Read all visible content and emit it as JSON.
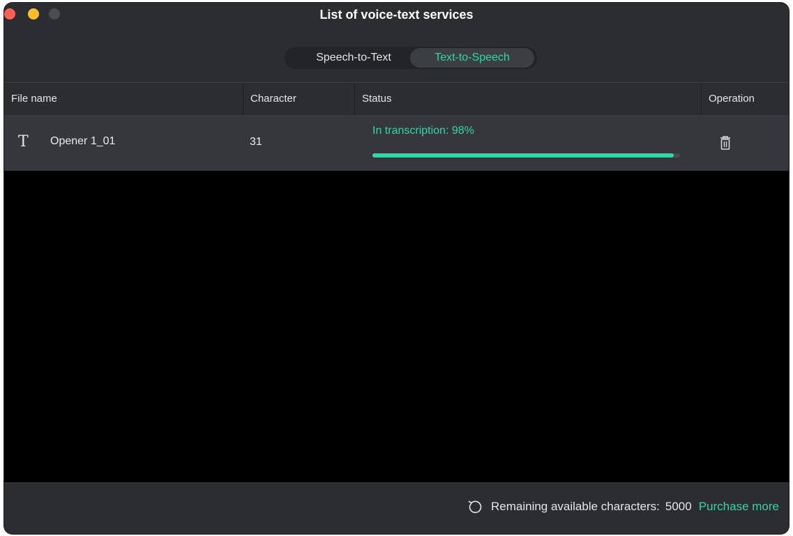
{
  "window": {
    "title": "List of voice-text services"
  },
  "tabs": [
    {
      "label": "Speech-to-Text",
      "active": false
    },
    {
      "label": "Text-to-Speech",
      "active": true
    }
  ],
  "table": {
    "columns": [
      "File name",
      "Character",
      "Status",
      "Operation"
    ],
    "rows": [
      {
        "icon": "text-type-icon",
        "icon_glyph": "T",
        "file_name": "Opener 1_01",
        "characters": "31",
        "status": "In transcription: 98%",
        "progress": 0.98,
        "operation_icon": "trash-icon"
      }
    ]
  },
  "footer": {
    "icon": "refresh-icon",
    "remaining_label": "Remaining available characters:",
    "remaining_value": "5000",
    "purchase_label": "Purchase more"
  },
  "colors": {
    "accent": "#33d6a6",
    "window_bg": "#2b2d31",
    "row_bg": "#35373c",
    "content_bg": "#000000",
    "close": "#fe5f57",
    "minimize": "#febc2e",
    "maximize_disabled": "#4a4c51"
  }
}
